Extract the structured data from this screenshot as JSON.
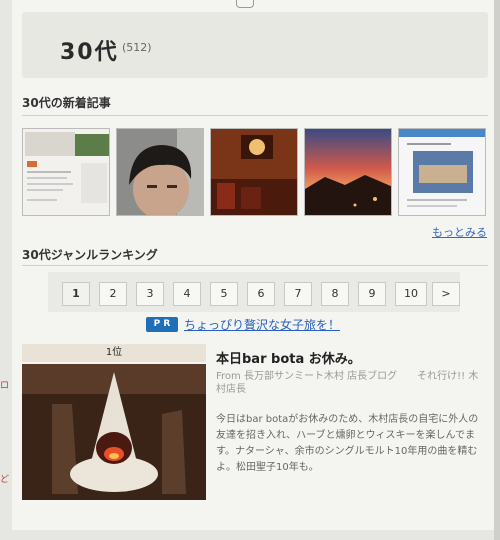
{
  "header": {
    "title": "30代",
    "count": "(512)"
  },
  "new_articles": {
    "heading": "30代の新着記事",
    "thumbnails": [
      {
        "icon": "webpage-screenshot-thumb"
      },
      {
        "icon": "portrait-photo-thumb"
      },
      {
        "icon": "interior-lamp-thumb"
      },
      {
        "icon": "sunset-sky-thumb"
      },
      {
        "icon": "blog-page-thumb"
      }
    ],
    "more_label": "もっとみる"
  },
  "ranking": {
    "heading": "30代ジャンルランキング",
    "pages": [
      "1",
      "2",
      "3",
      "4",
      "5",
      "6",
      "7",
      "8",
      "9",
      "10"
    ],
    "active_page": "1",
    "next_label": ">",
    "pr_badge": "P R",
    "pr_text": "ちょっぴり贅沢な女子旅を！"
  },
  "top_article": {
    "rank": "1位",
    "title": "本日bar bota お休み。",
    "from": "From  長万部サンミート木村 店長ブログ　　それ行け!! 木村店長",
    "body": "今日はbar botaがお休みのため、木村店長の自宅に外人の友達を招き入れ、ハーブと燻卵とウィスキーを楽しんでます。ナターシャ、余市のシングルモルト10年用の曲を精むよ。松田聖子10年も。"
  },
  "colors": {
    "link": "#3a67b5",
    "pr_badge": "#1e6fb8",
    "background": "#f4f4f1"
  }
}
